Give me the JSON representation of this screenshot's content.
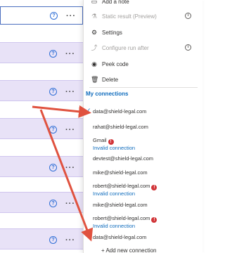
{
  "list": {
    "help_icon_glyph": "?",
    "more_glyph": "···"
  },
  "menu": {
    "items": [
      {
        "label": "Add a note",
        "icon": "note-icon",
        "disabled": false
      },
      {
        "label": "Static result (Preview)",
        "icon": "flask-icon",
        "disabled": true,
        "info": true
      },
      {
        "label": "Settings",
        "icon": "gear-icon",
        "disabled": false
      },
      {
        "label": "Configure run after",
        "icon": "run-after-icon",
        "disabled": true,
        "info": true
      },
      {
        "label": "Peek code",
        "icon": "eye-icon",
        "disabled": false
      },
      {
        "label": "Delete",
        "icon": "trash-icon",
        "disabled": false
      }
    ],
    "info_glyph": "i"
  },
  "connections": {
    "heading": "My connections",
    "items": [
      {
        "email": "data@shield-legal.com",
        "selected": true
      },
      {
        "email": "rahat@shield-legal.com"
      },
      {
        "email": "Gmail",
        "warning": true,
        "invalid": "Invalid connection"
      },
      {
        "email": "devtest@shield-legal.com"
      },
      {
        "email": "mike@shield-legal.com"
      },
      {
        "email": "robert@shield-legal.com",
        "warning": true,
        "invalid": "Invalid connection"
      },
      {
        "email": "mike@shield-legal.com"
      },
      {
        "email": "robert@shield-legal.com",
        "warning": true,
        "invalid": "Invalid connection"
      },
      {
        "email": "data@shield-legal.com"
      }
    ],
    "add_label": "+ Add new connection",
    "check_glyph": "✓",
    "warning_glyph": "!"
  },
  "colors": {
    "accent": "#0f6cbd",
    "row_purple": "#e8e2f7",
    "arrow": "#e0523f",
    "warning": "#d13438"
  }
}
